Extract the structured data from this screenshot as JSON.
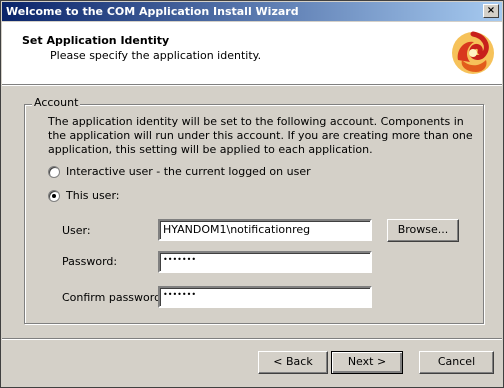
{
  "window": {
    "title": "Welcome to the COM Application Install Wizard",
    "close_glyph": "×"
  },
  "header": {
    "title": "Set Application Identity",
    "subtitle": "Please specify the application identity.",
    "logo_icon": "wizard-swirl-icon"
  },
  "account": {
    "group_label": "Account",
    "description": "The application identity will be set to the following account.  Components in the application will run under this account.  If you are creating more than one application, this setting will be applied to each application.",
    "options": [
      {
        "label": "Interactive user - the current logged on user",
        "mnemonic": "I",
        "selected": false
      },
      {
        "label": "This user:",
        "mnemonic": "T",
        "selected": true
      }
    ],
    "user_label": "User:",
    "user_value": "HYANDOM1\\notificationreg",
    "password_label": "Password:",
    "password_value": "•••••••",
    "confirm_label": "Confirm password:",
    "confirm_value": "•••••••",
    "browse_label": "Browse..."
  },
  "footer": {
    "back_label": "< Back",
    "next_label": "Next >",
    "cancel_label": "Cancel"
  }
}
